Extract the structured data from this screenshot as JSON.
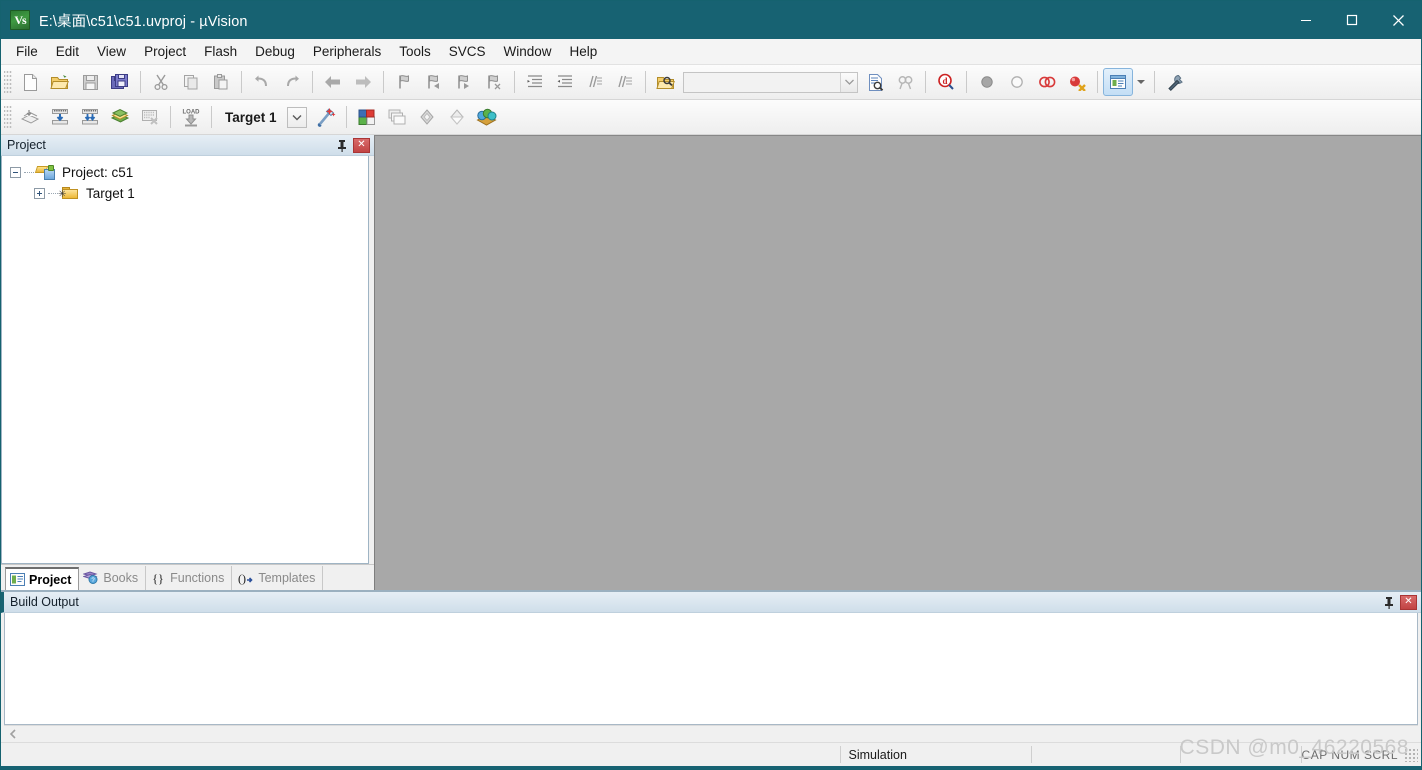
{
  "window": {
    "title": "E:\\桌面\\c51\\c51.uvproj - µVision",
    "app_icon": "keil-uvision-icon",
    "minimize_label": "Minimize",
    "maximize_label": "Maximize",
    "close_label": "Close",
    "titlebar_color": "#176272",
    "editor_background": "#a8a8a8"
  },
  "menu": {
    "items": [
      {
        "label": "File"
      },
      {
        "label": "Edit"
      },
      {
        "label": "View"
      },
      {
        "label": "Project"
      },
      {
        "label": "Flash"
      },
      {
        "label": "Debug"
      },
      {
        "label": "Peripherals"
      },
      {
        "label": "Tools"
      },
      {
        "label": "SVCS"
      },
      {
        "label": "Window"
      },
      {
        "label": "Help"
      }
    ]
  },
  "toolbar_file": {
    "buttons": [
      {
        "name": "new-file-icon",
        "tip": "New"
      },
      {
        "name": "open-file-icon",
        "tip": "Open"
      },
      {
        "name": "save-icon",
        "tip": "Save"
      },
      {
        "name": "save-all-icon",
        "tip": "Save All"
      },
      {
        "name": "cut-icon",
        "tip": "Cut"
      },
      {
        "name": "copy-icon",
        "tip": "Copy"
      },
      {
        "name": "paste-icon",
        "tip": "Paste"
      },
      {
        "name": "undo-icon",
        "tip": "Undo"
      },
      {
        "name": "redo-icon",
        "tip": "Redo"
      },
      {
        "name": "navigate-back-icon",
        "tip": "Back"
      },
      {
        "name": "navigate-forward-icon",
        "tip": "Forward"
      },
      {
        "name": "bookmark-toggle-icon",
        "tip": "Insert/Remove Bookmark"
      },
      {
        "name": "bookmark-prev-icon",
        "tip": "Previous Bookmark"
      },
      {
        "name": "bookmark-next-icon",
        "tip": "Next Bookmark"
      },
      {
        "name": "bookmark-clear-icon",
        "tip": "Clear All Bookmarks"
      },
      {
        "name": "indent-icon",
        "tip": "Indent Selection"
      },
      {
        "name": "outdent-icon",
        "tip": "Outdent Selection"
      },
      {
        "name": "comment-icon",
        "tip": "Comment Selection"
      },
      {
        "name": "uncomment-icon",
        "tip": "Uncomment Selection"
      },
      {
        "name": "find-in-files-icon",
        "tip": "Find in Files"
      },
      {
        "name": "incremental-find-icon",
        "tip": "Incremental Find"
      },
      {
        "name": "find-icon",
        "tip": "Find"
      },
      {
        "name": "browse-symbol-icon",
        "tip": "Browse Symbol"
      },
      {
        "name": "breakpoint-icon",
        "tip": "Insert/Remove Breakpoint"
      },
      {
        "name": "enable-breakpoint-icon",
        "tip": "Enable/Disable Breakpoint"
      },
      {
        "name": "disable-all-breakpoints-icon",
        "tip": "Disable All Breakpoints"
      },
      {
        "name": "kill-all-breakpoints-icon",
        "tip": "Kill All Breakpoints"
      },
      {
        "name": "configuration-wizard-icon",
        "tip": "Configuration Wizard"
      },
      {
        "name": "utilities-wrench-icon",
        "tip": "Configure"
      }
    ],
    "search_combo": {
      "value": "",
      "placeholder": ""
    }
  },
  "toolbar_build": {
    "buttons": [
      {
        "name": "translate-file-icon",
        "tip": "Translate Current File"
      },
      {
        "name": "build-target-icon",
        "tip": "Build Target"
      },
      {
        "name": "rebuild-all-icon",
        "tip": "Rebuild All Target Files"
      },
      {
        "name": "batch-build-icon",
        "tip": "Batch Build"
      },
      {
        "name": "stop-build-icon",
        "tip": "Stop Build"
      },
      {
        "name": "download-icon",
        "tip": "Download"
      },
      {
        "name": "target-options-icon",
        "tip": "Options for Target"
      },
      {
        "name": "manage-project-items-icon",
        "tip": "Manage Project Items"
      },
      {
        "name": "multi-project-icon",
        "tip": "Manage Multi-Project Workspace"
      },
      {
        "name": "source-browse-icon",
        "tip": "Source Browse"
      },
      {
        "name": "svcs-icon",
        "tip": "SVCS"
      },
      {
        "name": "pack-installer-icon",
        "tip": "Pack Installer"
      }
    ],
    "target_selector": {
      "value": "Target 1",
      "dropdown_icon": "chevron-down-icon"
    }
  },
  "project_panel": {
    "title": "Project",
    "pin_icon": "pin-icon",
    "close_icon": "close-icon",
    "tree": [
      {
        "label": "Project: c51",
        "expander": "minus",
        "icon": "project-icon",
        "level": 1
      },
      {
        "label": "Target 1",
        "expander": "plus",
        "icon": "target-folder-icon",
        "level": 2
      }
    ],
    "tabs": [
      {
        "label": "Project",
        "icon": "project-tab-icon",
        "active": true
      },
      {
        "label": "Books",
        "icon": "books-tab-icon",
        "active": false
      },
      {
        "label": "Functions",
        "icon": "functions-tab-icon",
        "active": false
      },
      {
        "label": "Templates",
        "icon": "templates-tab-icon",
        "active": false
      }
    ]
  },
  "build_output": {
    "title": "Build Output",
    "pin_icon": "pin-icon",
    "close_icon": "close-icon",
    "content": "",
    "scroll_left_icon": "chevron-left-icon"
  },
  "status_bar": {
    "message": "",
    "simulation": "Simulation",
    "field_2": "",
    "field_3": "",
    "indicators": "CAP NUM SCRL"
  },
  "watermark": {
    "text": "CSDN @m0_46220568"
  }
}
